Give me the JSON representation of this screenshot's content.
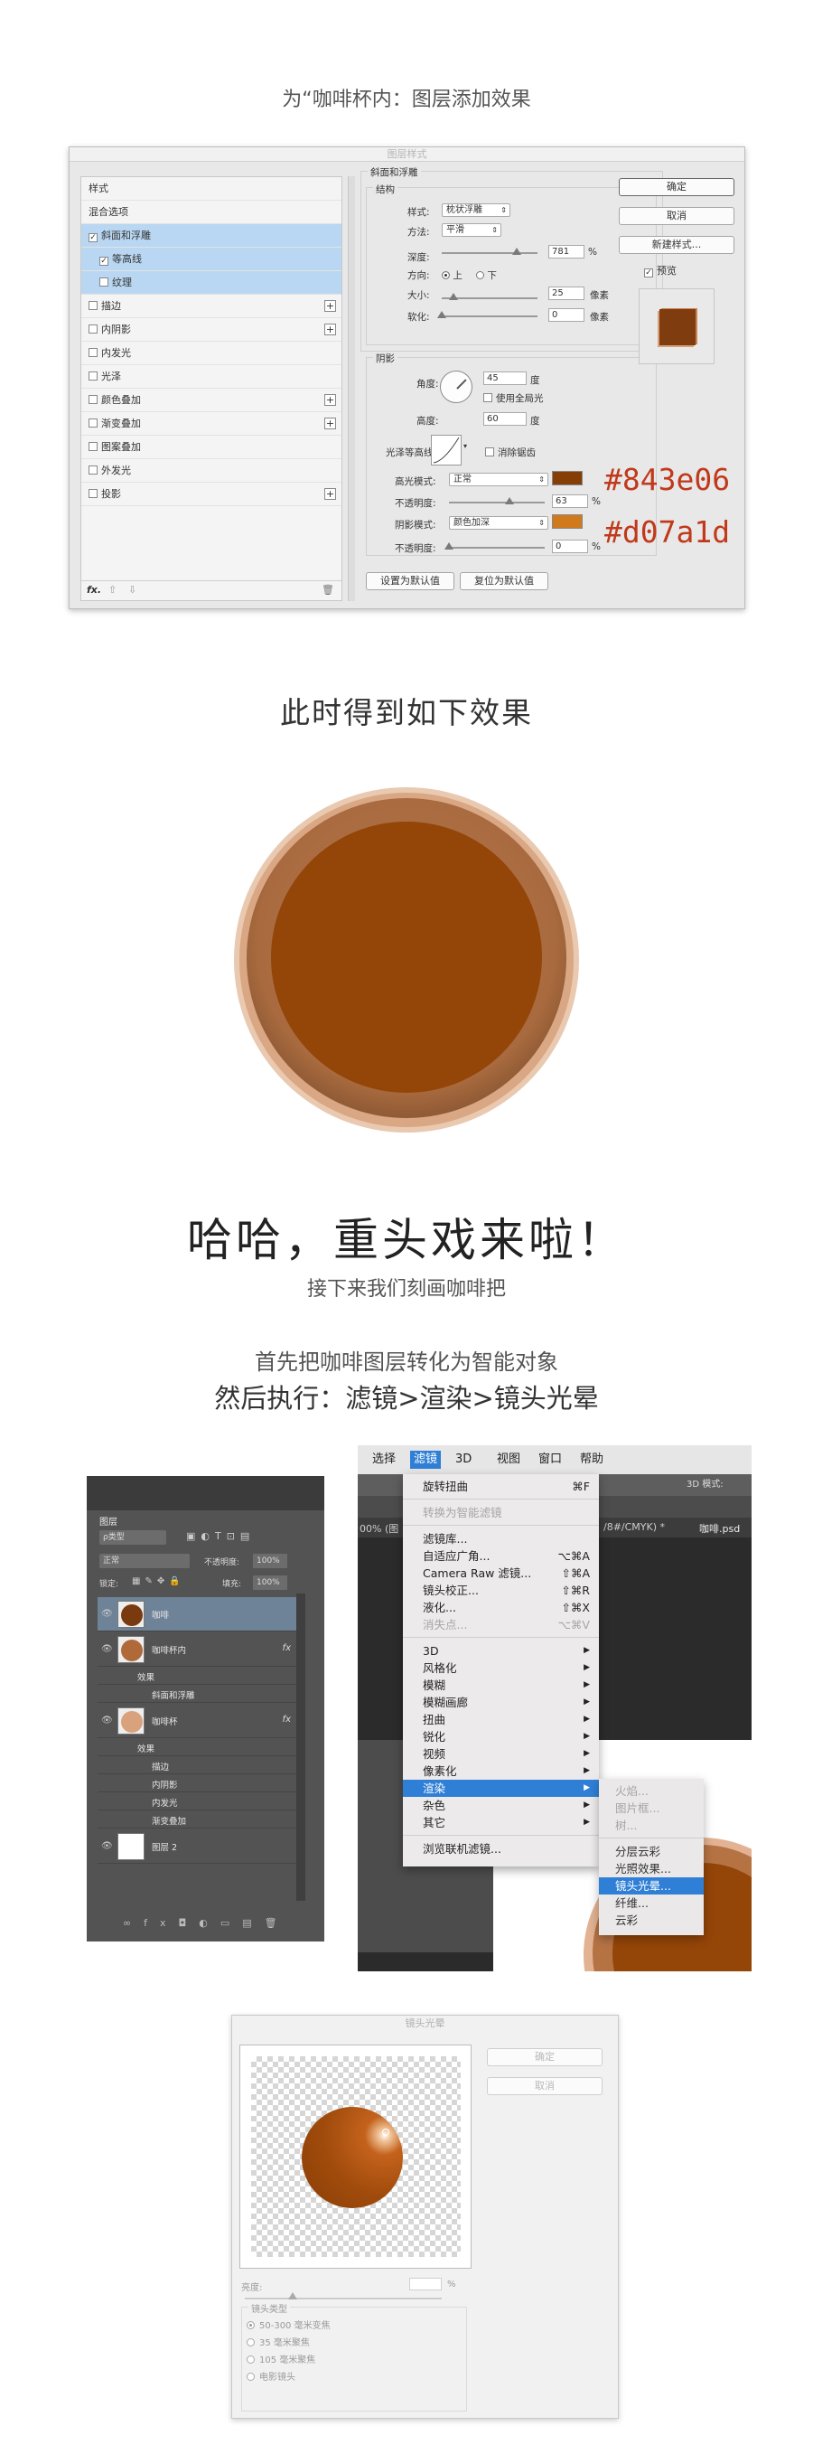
{
  "captions": {
    "step1": "为“咖啡杯内：图层添加效果",
    "result": "此时得到如下效果",
    "haha": "哈哈，重头戏来啦！",
    "next": "接下来我们刻画咖啡把",
    "convert": "首先把咖啡图层转化为智能对象",
    "exec": "然后执行：滤镜>渲染>镜头光晕"
  },
  "layer_style": {
    "title": "图层样式",
    "list": [
      {
        "label": "样式",
        "checkbox": false,
        "selected": false,
        "plus": false
      },
      {
        "label": "混合选项",
        "checkbox": false,
        "selected": false,
        "plus": false
      },
      {
        "label": "斜面和浮雕",
        "checkbox": true,
        "checked": true,
        "selected": true,
        "plus": false
      },
      {
        "label": "等高线",
        "checkbox": true,
        "checked": true,
        "selected": true,
        "plus": false,
        "indent": true
      },
      {
        "label": "纹理",
        "checkbox": true,
        "checked": false,
        "selected": true,
        "plus": false,
        "indent": true
      },
      {
        "label": "描边",
        "checkbox": true,
        "checked": false,
        "selected": false,
        "plus": true
      },
      {
        "label": "内阴影",
        "checkbox": true,
        "checked": false,
        "selected": false,
        "plus": true
      },
      {
        "label": "内发光",
        "checkbox": true,
        "checked": false,
        "selected": false,
        "plus": false
      },
      {
        "label": "光泽",
        "checkbox": true,
        "checked": false,
        "selected": false,
        "plus": false
      },
      {
        "label": "颜色叠加",
        "checkbox": true,
        "checked": false,
        "selected": false,
        "plus": true
      },
      {
        "label": "渐变叠加",
        "checkbox": true,
        "checked": false,
        "selected": false,
        "plus": true
      },
      {
        "label": "图案叠加",
        "checkbox": true,
        "checked": false,
        "selected": false,
        "plus": false
      },
      {
        "label": "外发光",
        "checkbox": true,
        "checked": false,
        "selected": false,
        "plus": false
      },
      {
        "label": "投影",
        "checkbox": true,
        "checked": false,
        "selected": false,
        "plus": true
      }
    ],
    "fx": "fx.",
    "bevel_title": "斜面和浮雕",
    "structure": "结构",
    "style_label": "样式:",
    "style_value": "枕状浮雕",
    "technique_label": "方法:",
    "technique_value": "平滑",
    "depth_label": "深度:",
    "depth_value": "781",
    "pct": "%",
    "direction_label": "方向:",
    "up": "上",
    "down": "下",
    "size_label": "大小:",
    "size_value": "25",
    "px": "像素",
    "soften_label": "软化:",
    "soften_value": "0",
    "shading": "阴影",
    "angle_label": "角度:",
    "angle_value": "45",
    "deg": "度",
    "global_light": "使用全局光",
    "altitude_label": "高度:",
    "altitude_value": "60",
    "gloss_label": "光泽等高线:",
    "antialias": "消除锯齿",
    "highlight_label": "高光模式:",
    "highlight_mode": "正常",
    "opacity_label": "不透明度:",
    "highlight_opacity": "63",
    "shadow_label": "阴影模式:",
    "shadow_mode": "颜色加深",
    "shadow_opacity": "0",
    "make_default": "设置为默认值",
    "reset_default": "复位为默认值",
    "ok": "确定",
    "cancel": "取消",
    "new_style": "新建样式...",
    "preview": "预览"
  },
  "colors": {
    "highlight_hex": "#843e06",
    "shadow_hex": "#d07a1d",
    "annotation_red": "#c0391b"
  },
  "layers_panel": {
    "tab": "图层",
    "kind": "ρ类型",
    "mode": "正常",
    "opacity_label": "不透明度:",
    "opacity_value": "100%",
    "lock_label": "锁定:",
    "fill_label": "填充:",
    "fill_value": "100%",
    "rows": [
      {
        "name": "咖啡",
        "selected": true
      },
      {
        "name": "咖啡杯内",
        "fx": "fx"
      },
      {
        "name": "效果",
        "sub": 1
      },
      {
        "name": "斜面和浮雕",
        "sub": 2
      },
      {
        "name": "咖啡杯",
        "fx": "fx"
      },
      {
        "name": "效果",
        "sub": 1
      },
      {
        "name": "描边",
        "sub": 2
      },
      {
        "name": "内阴影",
        "sub": 2
      },
      {
        "name": "内发光",
        "sub": 2
      },
      {
        "name": "渐变叠加",
        "sub": 2
      },
      {
        "name": "图层 2"
      }
    ]
  },
  "menubar": [
    "选择",
    "滤镜",
    "3D",
    "视图",
    "窗口",
    "帮助"
  ],
  "filter_menu": [
    {
      "label": "旋转扭曲",
      "sc": "⌘F"
    },
    {
      "sep": true
    },
    {
      "label": "转换为智能滤镜",
      "dis": true
    },
    {
      "sep": true
    },
    {
      "label": "滤镜库..."
    },
    {
      "label": "自适应广角...",
      "sc": "⌥⌘A"
    },
    {
      "label": "Camera Raw 滤镜...",
      "sc": "⇧⌘A"
    },
    {
      "label": "镜头校正...",
      "sc": "⇧⌘R"
    },
    {
      "label": "液化...",
      "sc": "⇧⌘X"
    },
    {
      "label": "消失点...",
      "sc": "⌥⌘V",
      "dis": true
    },
    {
      "sep": true
    },
    {
      "label": "3D",
      "arrow": true
    },
    {
      "label": "风格化",
      "arrow": true
    },
    {
      "label": "模糊",
      "arrow": true
    },
    {
      "label": "模糊画廊",
      "arrow": true
    },
    {
      "label": "扭曲",
      "arrow": true
    },
    {
      "label": "锐化",
      "arrow": true
    },
    {
      "label": "视频",
      "arrow": true
    },
    {
      "label": "像素化",
      "arrow": true
    },
    {
      "label": "渲染",
      "arrow": true,
      "hl": true
    },
    {
      "label": "杂色",
      "arrow": true
    },
    {
      "label": "其它",
      "arrow": true
    },
    {
      "sep": true
    },
    {
      "label": "浏览联机滤镜..."
    }
  ],
  "render_submenu": [
    {
      "label": "火焰...",
      "dis": true
    },
    {
      "label": "图片框...",
      "dis": true
    },
    {
      "label": "树...",
      "dis": true
    },
    {
      "sep": true
    },
    {
      "label": "分层云彩"
    },
    {
      "label": "光照效果..."
    },
    {
      "label": "镜头光晕...",
      "hl": true
    },
    {
      "label": "纤维..."
    },
    {
      "label": "云彩"
    }
  ],
  "doc_tabs": [
    "00% (图",
    "/8#/CMYK) *",
    "咖啡.psd @"
  ],
  "lens_flare": {
    "title": "镜头光晕",
    "ok": "确定",
    "cancel": "取消",
    "brightness_label": "亮度:",
    "brightness_value": "%",
    "lens_type": "镜头类型",
    "types": [
      "50-300 毫米变焦",
      "35 毫米聚焦",
      "105 毫米聚焦",
      "电影镜头"
    ]
  }
}
